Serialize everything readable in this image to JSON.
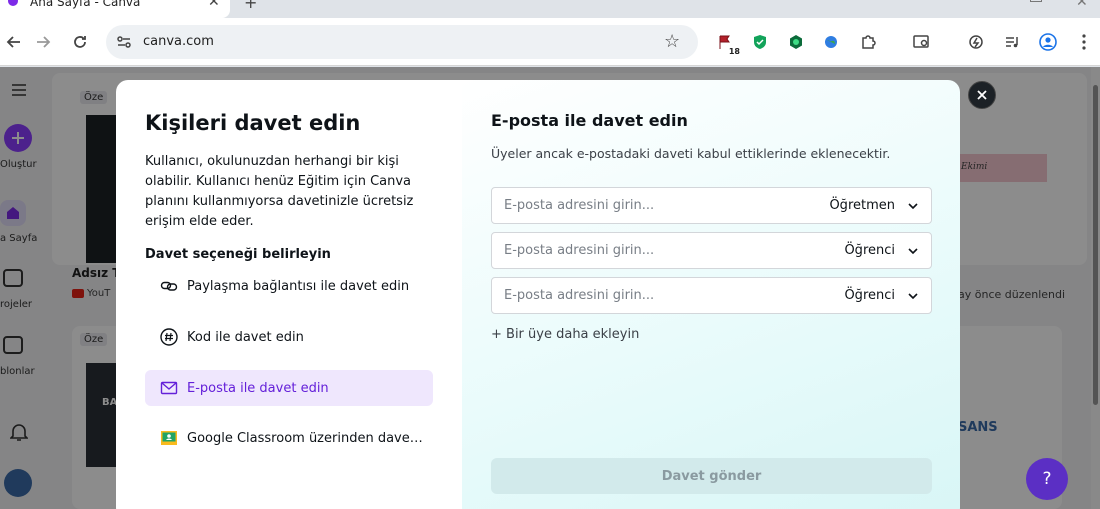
{
  "browser": {
    "tab_title": "Ana Sayfa - Canva",
    "url": "canva.com",
    "extension_badge": "18"
  },
  "background": {
    "rail_create": "Oluştur",
    "rail_home": "a Sayfa",
    "rail_projects": "rojeler",
    "rail_templates": "blonlar",
    "badge": "Öze",
    "doc_title": "Adsız T",
    "doc_source": "YouT",
    "edited": "ay önce düzenlendi",
    "pink_thumb_text": "Ekimi",
    "dark_thumb_text": "BA",
    "logo_text": "SANS"
  },
  "modal": {
    "left": {
      "title": "Kişileri davet edin",
      "description": "Kullanıcı, okulunuzdan herhangi bir kişi olabilir. Kullanıcı henüz Eğitim için Canva planını kullanmıyorsa davetinizle ücretsiz erişim elde eder.",
      "subtitle": "Davet seçeneği belirleyin",
      "options": [
        {
          "label": "Paylaşma bağlantısı ile davet edin",
          "icon": "link-icon"
        },
        {
          "label": "Kod ile davet edin",
          "icon": "hashtag-icon"
        },
        {
          "label": "E-posta ile davet edin",
          "icon": "envelope-icon",
          "selected": true
        },
        {
          "label": "Google Classroom üzerinden davet edin",
          "icon": "google-classroom-icon"
        }
      ]
    },
    "right": {
      "title": "E-posta ile davet edin",
      "description": "Üyeler ancak e-postadaki daveti kabul ettiklerinde eklenecektir.",
      "email_rows": [
        {
          "placeholder": "E-posta adresini girin...",
          "role": "Öğretmen"
        },
        {
          "placeholder": "E-posta adresini girin...",
          "role": "Öğrenci"
        },
        {
          "placeholder": "E-posta adresini girin...",
          "role": "Öğrenci"
        }
      ],
      "add_member": "+ Bir üye daha ekleyin",
      "send_button": "Davet gönder"
    }
  },
  "help": "?",
  "colors": {
    "accent_purple": "#7d2ae8",
    "selected_bg": "#efe7fd",
    "selected_text": "#6420d9",
    "send_disabled_bg": "#d2eaeb"
  }
}
